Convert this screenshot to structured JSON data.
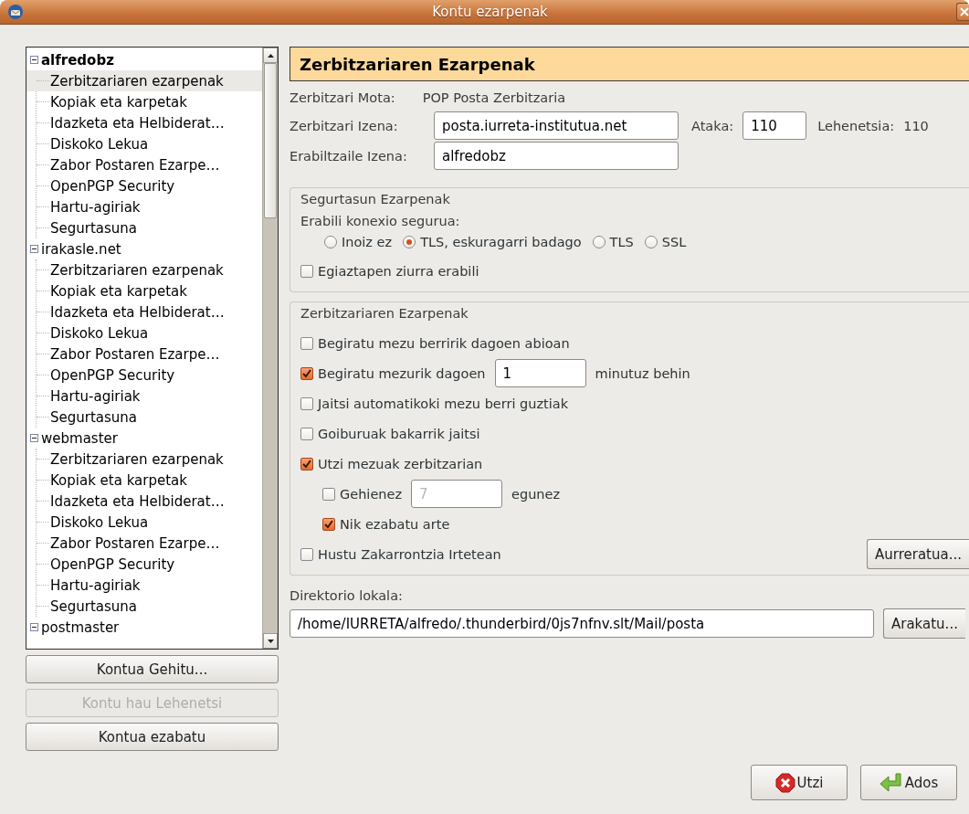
{
  "window": {
    "title": "Kontu ezarpenak"
  },
  "accounts": [
    {
      "name": "alfredobz",
      "default": true,
      "expanded": true,
      "children": [
        {
          "label": "Zerbitzariaren ezarpenak",
          "selected": true
        },
        {
          "label": "Kopiak eta karpetak",
          "selected": false
        },
        {
          "label": "Idazketa eta Helbiderat…",
          "selected": false
        },
        {
          "label": "Diskoko Lekua",
          "selected": false
        },
        {
          "label": "Zabor Postaren Ezarpe…",
          "selected": false
        },
        {
          "label": "OpenPGP Security",
          "selected": false
        },
        {
          "label": "Hartu-agiriak",
          "selected": false
        },
        {
          "label": "Segurtasuna",
          "selected": false
        }
      ]
    },
    {
      "name": "irakasle.net",
      "default": false,
      "expanded": true,
      "children": [
        {
          "label": "Zerbitzariaren ezarpenak",
          "selected": false
        },
        {
          "label": "Kopiak eta karpetak",
          "selected": false
        },
        {
          "label": "Idazketa eta Helbiderat…",
          "selected": false
        },
        {
          "label": "Diskoko Lekua",
          "selected": false
        },
        {
          "label": "Zabor Postaren Ezarpe…",
          "selected": false
        },
        {
          "label": "OpenPGP Security",
          "selected": false
        },
        {
          "label": "Hartu-agiriak",
          "selected": false
        },
        {
          "label": "Segurtasuna",
          "selected": false
        }
      ]
    },
    {
      "name": "webmaster",
      "default": false,
      "expanded": true,
      "children": [
        {
          "label": "Zerbitzariaren ezarpenak",
          "selected": false
        },
        {
          "label": "Kopiak eta karpetak",
          "selected": false
        },
        {
          "label": "Idazketa eta Helbiderat…",
          "selected": false
        },
        {
          "label": "Diskoko Lekua",
          "selected": false
        },
        {
          "label": "Zabor Postaren Ezarpe…",
          "selected": false
        },
        {
          "label": "OpenPGP Security",
          "selected": false
        },
        {
          "label": "Hartu-agiriak",
          "selected": false
        },
        {
          "label": "Segurtasuna",
          "selected": false
        }
      ]
    },
    {
      "name": "postmaster",
      "default": false,
      "expanded": true
    }
  ],
  "account_buttons": [
    {
      "label": "Kontua Gehitu...",
      "disabled": false
    },
    {
      "label": "Kontu hau Lehenetsi",
      "disabled": true
    },
    {
      "label": "Kontua ezabatu",
      "disabled": false
    }
  ],
  "page": {
    "title": "Zerbitzariaren Ezarpenak",
    "server_type": {
      "label": "Zerbitzari Mota:",
      "value": "POP Posta Zerbitzaria"
    },
    "server_name": {
      "label": "Zerbitzari Izena:",
      "value": "posta.iurreta-institutua.net"
    },
    "port": {
      "label": "Ataka:",
      "value": "110"
    },
    "default_port": {
      "label": "Lehenetsia:",
      "value": "110"
    },
    "user_name": {
      "label": "Erabiltzaile Izena:",
      "value": "alfredobz"
    },
    "security": {
      "title": "Segurtasun Ezarpenak",
      "connection_label": "Erabili konexio segurua:",
      "options": [
        {
          "label": "Inoiz ez",
          "selected": false
        },
        {
          "label": "TLS, eskuragarri badago",
          "selected": true
        },
        {
          "label": "TLS",
          "selected": false
        },
        {
          "label": "SSL",
          "selected": false
        }
      ],
      "secure_auth": {
        "label": "Egiaztapen ziurra erabili",
        "checked": false
      }
    },
    "server": {
      "title": "Zerbitzariaren Ezarpenak",
      "advanced_button": "Aurreratua...",
      "options": [
        {
          "kind": "checkbox",
          "label": "Begiratu mezu berririk dagoen abioan",
          "checked": false
        },
        {
          "kind": "checkbox_field",
          "label": "Begiratu mezurik dagoen",
          "checked": true,
          "value": "1",
          "unit": "minutuz behin",
          "field_disabled": false
        },
        {
          "kind": "checkbox",
          "label": "Jaitsi automatikoki mezu berri guztiak",
          "checked": false
        },
        {
          "kind": "checkbox",
          "label": "Goiburuak bakarrik jaitsi",
          "checked": false
        },
        {
          "kind": "checkbox",
          "label": "Utzi mezuak zerbitzarian",
          "checked": true,
          "children": [
            {
              "kind": "checkbox_field",
              "label": "Gehienez",
              "checked": false,
              "value": "7",
              "unit": "egunez",
              "field_disabled": true
            },
            {
              "kind": "checkbox",
              "label": "Nik ezabatu arte",
              "checked": true
            }
          ]
        },
        {
          "kind": "checkbox",
          "label": "Hustu Zakarrontzia Irtetean",
          "checked": false
        }
      ]
    },
    "local_directory": {
      "label": "Direktorio lokala:",
      "value": "/home/IURRETA/alfredo/.thunderbird/0js7nfnv.slt/Mail/posta",
      "browse_button": "Arakatu..."
    }
  },
  "dialog_buttons": [
    {
      "kind": "cancel",
      "label": "Utzi"
    },
    {
      "kind": "ok",
      "label": "Ados"
    }
  ]
}
